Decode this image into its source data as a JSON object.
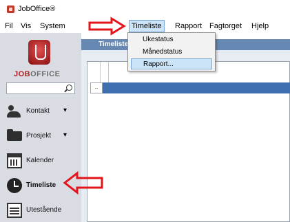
{
  "window": {
    "title": "JobOffice®"
  },
  "menubar": {
    "items": [
      "Fil",
      "Vis",
      "System",
      "Timeliste",
      "Rapport",
      "Fagtorget",
      "Hjelp"
    ],
    "active": "Timeliste"
  },
  "dropdown": {
    "items": [
      "Ukestatus",
      "Månedstatus",
      "Rapport..."
    ],
    "highlighted": "Rapport..."
  },
  "sidebar": {
    "logo": {
      "text_job": "JOB",
      "text_office": "OFFICE"
    },
    "search": {
      "placeholder": "",
      "icon": "search-icon"
    },
    "items": [
      {
        "label": "Kontakt",
        "icon": "contact-icon",
        "chevron": "▾",
        "bold": false
      },
      {
        "label": "Prosjekt",
        "icon": "folder-icon",
        "chevron": "▾",
        "bold": false
      },
      {
        "label": "Kalender",
        "icon": "calendar-icon",
        "chevron": "",
        "bold": false
      },
      {
        "label": "Timeliste",
        "icon": "clock-icon",
        "chevron": "",
        "bold": true
      },
      {
        "label": "Utestående",
        "icon": "register-icon",
        "chevron": "",
        "bold": false
      }
    ]
  },
  "content": {
    "tab_title": "Timeliste",
    "row_cell": ".."
  },
  "annotation": {
    "arrow_color": "#e3141b"
  },
  "colors": {
    "sidebar_bg": "#d9dde3",
    "tab_header": "#6688b2",
    "selected_row": "#3f6fb0",
    "menu_highlight": "#cce4f7"
  }
}
